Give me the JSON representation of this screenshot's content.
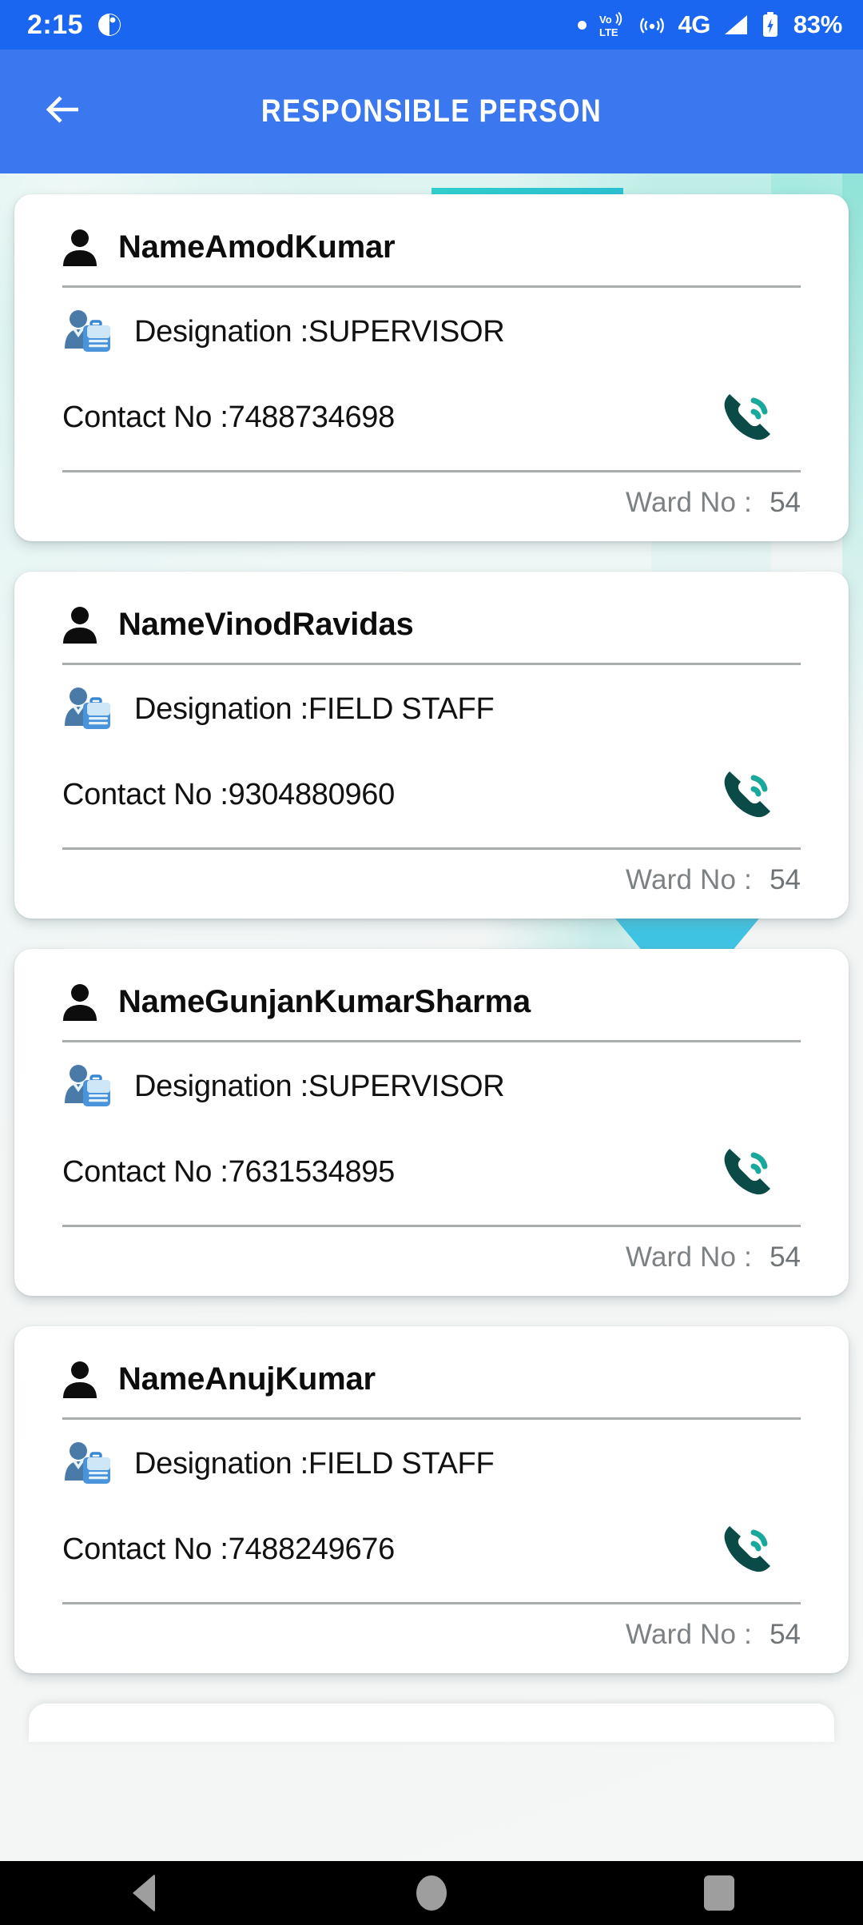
{
  "status_bar": {
    "clock": "2:15",
    "dnd_icon": "do-not-disturb-icon",
    "dot_icon": "dot-icon",
    "volte_icon": "volte-icon",
    "hotspot_icon": "hotspot-icon",
    "network_label": "4G",
    "signal_icon": "signal-bars-icon",
    "battery_icon": "battery-charging-icon",
    "battery_percent": "83%",
    "background_color": "#1a66f0"
  },
  "app_bar": {
    "back_icon": "arrow-left-icon",
    "title": "RESPONSIBLE PERSON",
    "background_color": "#3b78f0",
    "title_color": "#ffffff"
  },
  "labels": {
    "designation_prefix": "Designation :",
    "contact_prefix": "Contact No :",
    "ward_prefix": "Ward No :",
    "person_icon": "person-icon",
    "designation_icon": "employee-briefcase-icon",
    "call_icon": "phone-call-icon"
  },
  "theme": {
    "card_background": "#ffffff",
    "page_background": "#f4f6f6",
    "accent_teal": "#2fd0cd",
    "call_icon_dark": "#0a4a47",
    "call_icon_light": "#1aa89d",
    "divider": "#a9adad",
    "ward_text": "#7d8183"
  },
  "persons": [
    {
      "name": "NameAmodKumar",
      "designation_label": "Designation :SUPERVISOR",
      "designation_value": "SUPERVISOR",
      "contact_label": "Contact No :7488734698",
      "contact_value": "7488734698",
      "ward_label": "Ward No :",
      "ward_value": "54"
    },
    {
      "name": "NameVinodRavidas",
      "designation_label": "Designation :FIELD STAFF",
      "designation_value": "FIELD STAFF",
      "contact_label": "Contact No :9304880960",
      "contact_value": "9304880960",
      "ward_label": "Ward No :",
      "ward_value": "54"
    },
    {
      "name": "NameGunjanKumarSharma",
      "designation_label": "Designation :SUPERVISOR",
      "designation_value": "SUPERVISOR",
      "contact_label": "Contact No :7631534895",
      "contact_value": "7631534895",
      "ward_label": "Ward No :",
      "ward_value": "54"
    },
    {
      "name": "NameAnujKumar",
      "designation_label": "Designation :FIELD STAFF",
      "designation_value": "FIELD STAFF",
      "contact_label": "Contact No :7488249676",
      "contact_value": "7488249676",
      "ward_label": "Ward No :",
      "ward_value": "54"
    }
  ],
  "nav_bar": {
    "back_icon": "nav-back-icon",
    "home_icon": "nav-home-icon",
    "recents_icon": "nav-recents-icon",
    "background_color": "#000000"
  }
}
